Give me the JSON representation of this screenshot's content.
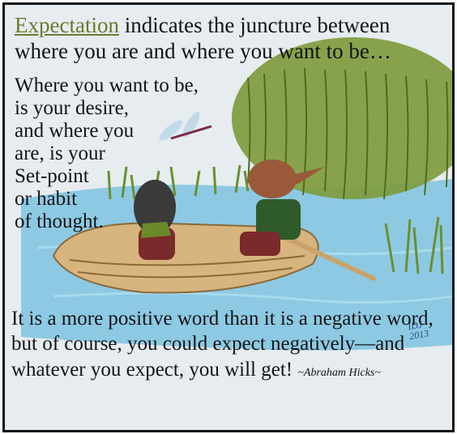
{
  "header": {
    "keyword": "Expectation",
    "rest_line1": " indicates the juncture between",
    "line2": "where you are and where you want to be…"
  },
  "side_quote": {
    "lines": [
      "Where you want to be,",
      "is your desire,",
      "and where you",
      "are, is your",
      "Set-point",
      "or habit",
      "of thought."
    ]
  },
  "bottom_quote": {
    "text": "It is a more positive word than it is a negative word, but of course, you could expect negatively—and whatever you expect, you will get!",
    "author": "~Abraham Hicks~"
  },
  "signature": {
    "text": "IDJ 2013"
  },
  "colors": {
    "keyword": "#6d7a2e",
    "water": "#7cc3e0",
    "boat": "#d8b47e",
    "willow": "#7d9a3a"
  }
}
